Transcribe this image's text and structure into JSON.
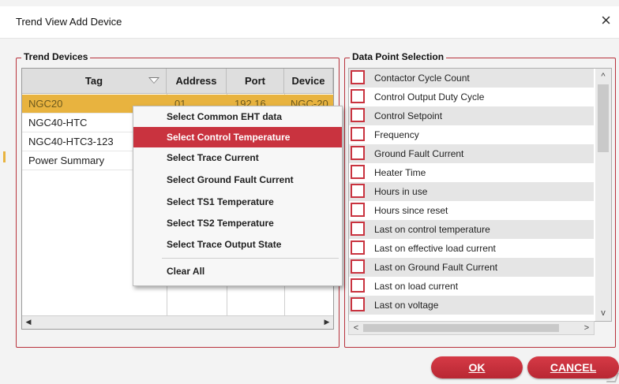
{
  "window": {
    "title": "Trend View Add Device",
    "close_glyph": "×"
  },
  "trend_devices": {
    "legend": "Trend Devices",
    "columns": [
      "Tag",
      "Address",
      "Port",
      "Device"
    ],
    "rows": [
      {
        "tag": "NGC20",
        "address": "01",
        "port": "192.16",
        "device": "NGC-20",
        "selected": true
      },
      {
        "tag": "NGC40-HTC"
      },
      {
        "tag": "NGC40-HTC3-123"
      },
      {
        "tag": "Power Summary"
      }
    ]
  },
  "context_menu": {
    "items": [
      "Select Common EHT data",
      "Select Control Temperature",
      "Select Trace Current",
      "Select Ground Fault Current",
      "Select TS1 Temperature",
      "Select TS2 Temperature",
      "Select Trace Output State"
    ],
    "highlighted_index": 1,
    "clear_all": "Clear All"
  },
  "data_point_selection": {
    "legend": "Data Point Selection",
    "items": [
      "Contactor Cycle Count",
      "Control Output Duty Cycle",
      "Control Setpoint",
      "Frequency",
      "Ground Fault Current",
      "Heater Time",
      "Hours in use",
      "Hours since reset",
      "Last on control temperature",
      "Last on effective load current",
      "Last on Ground Fault Current",
      "Last on load current",
      "Last on voltage"
    ]
  },
  "buttons": {
    "ok": "OK",
    "cancel": "CANCEL"
  },
  "colors": {
    "accent": "#c9333f",
    "selection": "#e8b33f"
  },
  "icons": {
    "sort": "sort-down-triangle-icon",
    "close": "close-icon"
  }
}
